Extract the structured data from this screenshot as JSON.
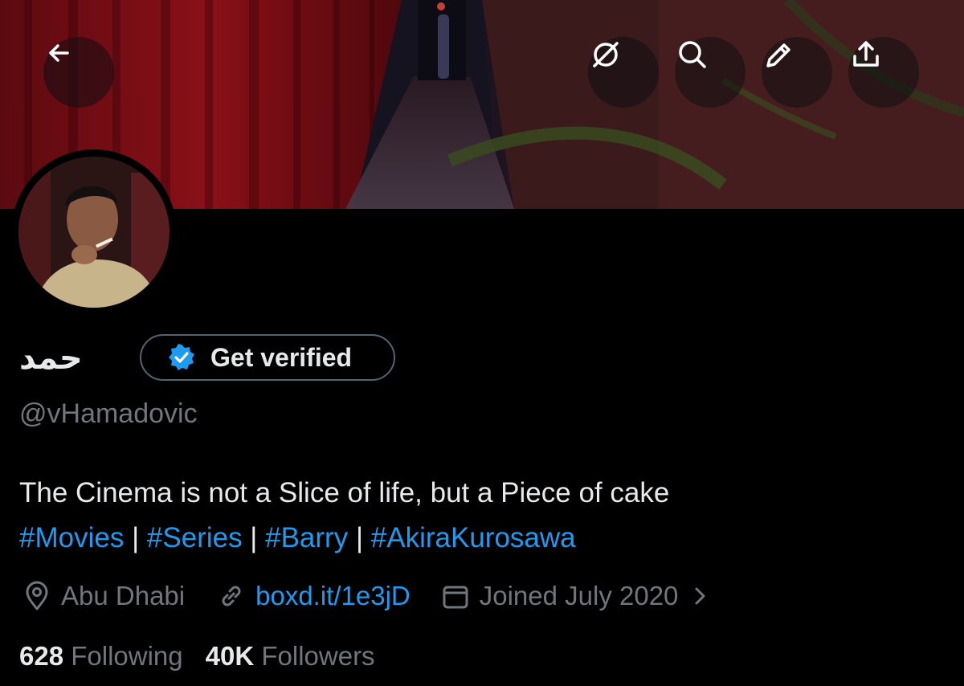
{
  "profile": {
    "display_name": "حمد",
    "verify_label": "Get verified",
    "handle": "@vHamadovic",
    "bio_line1": "The Cinema is not a Slice of life, but a Piece of cake",
    "hashtags": [
      "#Movies",
      "#Series",
      "#Barry",
      "#AkiraKurosawa"
    ],
    "hashtag_separator": "|",
    "location": "Abu Dhabi",
    "website": "boxd.it/1e3jD",
    "joined": "Joined July 2020",
    "following_count": "628",
    "following_label": "Following",
    "followers_count": "40K",
    "followers_label": "Followers"
  },
  "toolbar": {
    "back_icon": "arrow-left-icon",
    "grok_icon": "grok-icon",
    "search_icon": "search-icon",
    "edit_icon": "pencil-icon",
    "share_icon": "share-icon"
  },
  "colors": {
    "background": "#000000",
    "text_primary": "#e7e9ea",
    "text_secondary": "#71767b",
    "accent": "#1d9bf0",
    "pill_border": "#536471"
  }
}
